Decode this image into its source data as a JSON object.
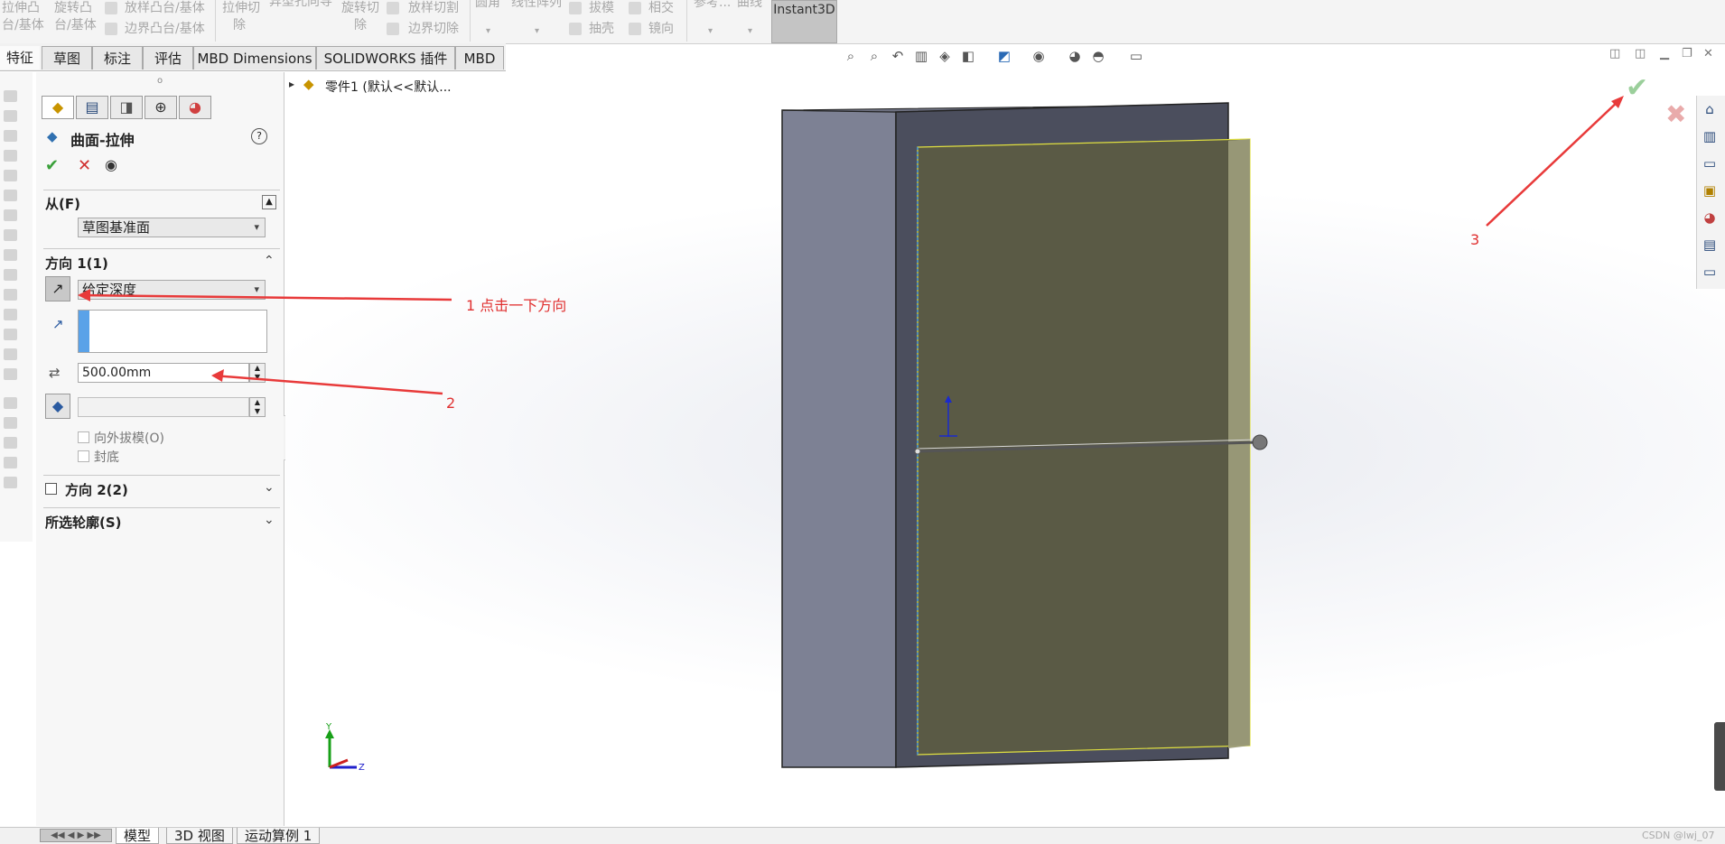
{
  "ribbon": {
    "items": [
      "拉伸凸",
      "台/基体",
      "旋转凸",
      "台/基体",
      "放样凸台/基体",
      "边界凸台/基体",
      "拉伸切",
      "除",
      "异型孔向导",
      "旋转切",
      "除",
      "放样切割",
      "边界切除",
      "圆角",
      "线性阵列",
      "拔模",
      "相交",
      "抽壳",
      "镜向",
      "参考...",
      "曲线"
    ],
    "instant3d": "Instant3D"
  },
  "tabs": [
    "特征",
    "草图",
    "标注",
    "评估",
    "MBD Dimensions",
    "SOLIDWORKS 插件",
    "MBD"
  ],
  "tree": {
    "root": "零件1 (默认<<默认..."
  },
  "pm": {
    "title": "曲面-拉伸",
    "help": "?",
    "from_label": "从(F)",
    "from_value": "草图基准面",
    "dir1_label": "方向 1(1)",
    "dir1_type": "给定深度",
    "depth": "500.00mm",
    "draft_outward": "向外拔模(O)",
    "cap_end": "封底",
    "dir2_label": "方向 2(2)",
    "contours_label": "所选轮廓(S)"
  },
  "annotations": {
    "note1": "1 点击一下方向",
    "note2": "2",
    "note3": "3"
  },
  "bottom_tabs": [
    "模型",
    "3D 视图",
    "运动算例 1"
  ],
  "watermark": "CSDN @lwj_07",
  "icons": {
    "confirm": "check-icon",
    "cancel": "x-icon",
    "preview": "eye-icon",
    "reverse": "reverse-direction-icon"
  },
  "colors": {
    "surface_fill": "#5c5c42",
    "surface_edge": "#e0e040",
    "box_front": "#4b4e5d",
    "box_side": "#7d8194",
    "annotation": "#e83a3a",
    "confirm_green": "#3aa03a",
    "cancel_red": "#d03030"
  }
}
